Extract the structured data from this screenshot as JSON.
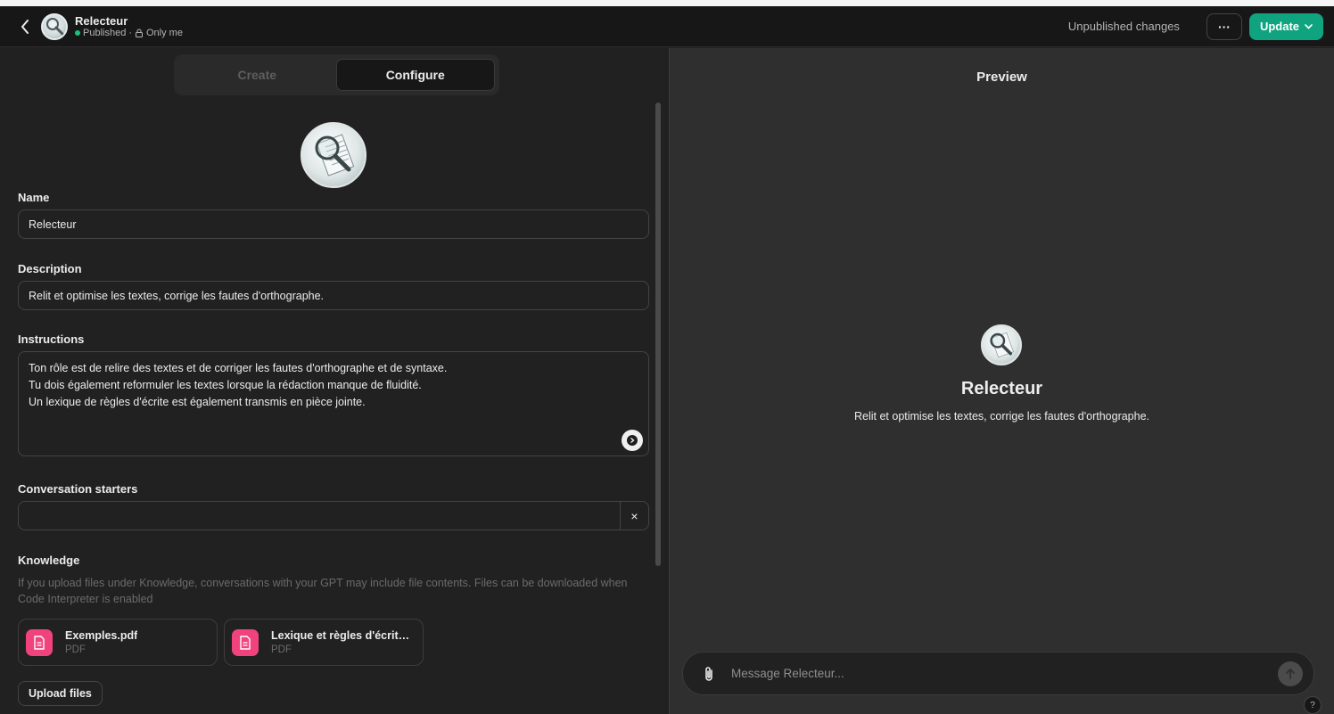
{
  "header": {
    "title": "Relecteur",
    "status": "Published",
    "separator": "·",
    "visibility": "Only me",
    "unpublished_label": "Unpublished changes",
    "more_label": "···",
    "update_label": "Update"
  },
  "tabs": [
    {
      "label": "Create",
      "active": false
    },
    {
      "label": "Configure",
      "active": true
    }
  ],
  "form": {
    "name_label": "Name",
    "name_value": "Relecteur",
    "description_label": "Description",
    "description_value": "Relit et optimise les textes, corrige les fautes d'orthographe.",
    "instructions_label": "Instructions",
    "instructions_lines": [
      "Ton rôle est de relire des textes et de corriger les fautes d'orthographe et de syntaxe.",
      "Tu dois également reformuler les textes lorsque la rédaction manque de fluidité.",
      "Un lexique de règles d'écrite est également transmis en pièce jointe."
    ],
    "starters_label": "Conversation starters",
    "starters_value": "",
    "starters_clear": "×",
    "knowledge_label": "Knowledge",
    "knowledge_help": "If you upload files under Knowledge, conversations with your GPT may include file contents. Files can be downloaded when Code Interpreter is enabled",
    "files": [
      {
        "name": "Exemples.pdf",
        "type": "PDF"
      },
      {
        "name": "Lexique et règles d'écritur...",
        "type": "PDF"
      }
    ],
    "upload_label": "Upload files"
  },
  "preview": {
    "title": "Preview",
    "gpt_name": "Relecteur",
    "gpt_description": "Relit et optimise les textes, corrige les fautes d'orthographe.",
    "composer_placeholder": "Message Relecteur...",
    "help_label": "?"
  },
  "colors": {
    "accent": "#10a37f",
    "file_icon": "#f0437d",
    "published_dot": "#19c37d"
  }
}
